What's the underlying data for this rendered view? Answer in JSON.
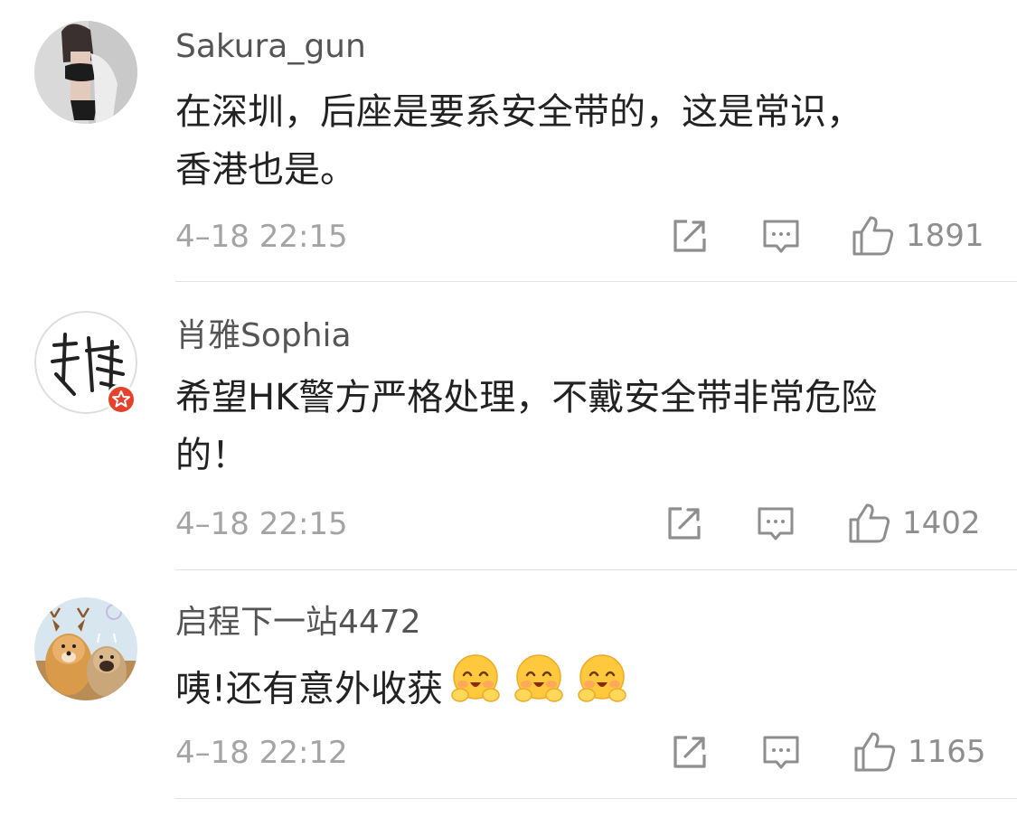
{
  "comments": [
    {
      "username": "Sakura_gun",
      "content_lines": [
        "在深圳，后座是要系安全带的，这是常识，",
        "香港也是。"
      ],
      "time": "4–18 22:15",
      "likes": "1891",
      "avatar_icon": "photo-avatar"
    },
    {
      "username": "肖雅Sophia",
      "content_lines": [
        "希望HK警方严格处理，不戴安全带非常危险",
        "的！"
      ],
      "time": "4–18 22:15",
      "likes": "1402",
      "avatar_icon": "calligraphy-avatar",
      "verified_badge": "verified-star-badge"
    },
    {
      "username": "启程下一站4472",
      "content_lines": [
        "咦!还有意外收获"
      ],
      "emoji_count": 3,
      "emoji_icon": "hug-emoji",
      "time": "4–18 22:12",
      "likes": "1165",
      "avatar_icon": "dogs-avatar"
    }
  ],
  "colors": {
    "username": "#555555",
    "content": "#222222",
    "meta": "#a4a4a4",
    "icon": "#8e8e8e",
    "divider": "#e2e2e2",
    "badge": "#e5412c"
  },
  "icons": {
    "share": "share-icon",
    "reply": "comment-icon",
    "like": "thumbs-up-icon"
  }
}
